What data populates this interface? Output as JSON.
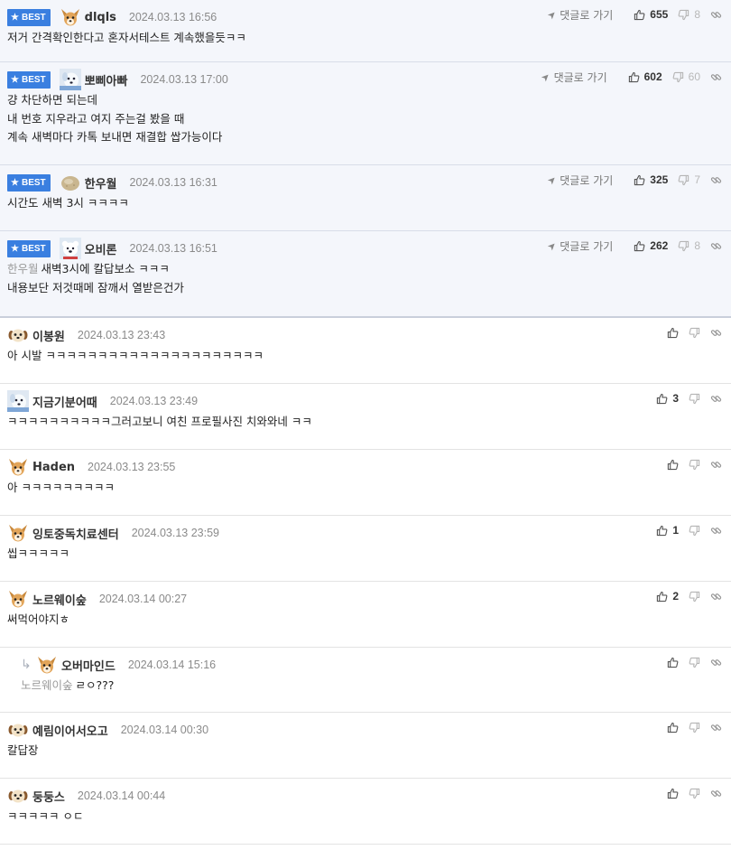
{
  "ui": {
    "best_label": "BEST",
    "goto_label": "댓글로 가기"
  },
  "comments": [
    {
      "best": true,
      "avatar": "dog-tan-icon",
      "nick": "dlqls",
      "date": "2024.03.13 16:56",
      "goto": true,
      "up": "655",
      "down": "8",
      "lines": [
        "저거 간격확인한다고 혼자서테스트 계속했을듯ㅋㅋ"
      ]
    },
    {
      "best": true,
      "avatar": "dog-white-icon",
      "nick": "뽀삐아빠",
      "date": "2024.03.13 17:00",
      "goto": true,
      "up": "602",
      "down": "60",
      "lines": [
        "걍 차단하면 되는데",
        "내 번호 지우라고 여지 주는걸 봤을 때",
        "계속 새벽마다 카톡 보내면 재결합 쌉가능이다"
      ]
    },
    {
      "best": true,
      "avatar": "potato-icon",
      "nick": "한우월",
      "date": "2024.03.13 16:31",
      "goto": true,
      "up": "325",
      "down": "7",
      "lines": [
        "시간도 새벽 3시 ㅋㅋㅋㅋ"
      ]
    },
    {
      "best": true,
      "avatar": "polar-bear-icon",
      "nick": "오비론",
      "date": "2024.03.13 16:51",
      "goto": true,
      "up": "262",
      "down": "8",
      "quote": "한우월",
      "lines": [
        "새벽3시에 칼답보소 ㅋㅋㅋ",
        "내용보단 저것때메 잠깨서 열받은건가"
      ]
    },
    {
      "best": false,
      "avatar": "puppy-icon",
      "nick": "이봉원",
      "date": "2024.03.13 23:43",
      "up": "",
      "down": "",
      "lines": [
        "아 시발 ㅋㅋㅋㅋㅋㅋㅋㅋㅋㅋㅋㅋㅋㅋㅋㅋㅋㅋㅋㅋㅋ"
      ]
    },
    {
      "best": false,
      "avatar": "dog-white-icon",
      "nick": "지금기분어때",
      "date": "2024.03.13 23:49",
      "up": "3",
      "down": "",
      "lines": [
        "ㅋㅋㅋㅋㅋㅋㅋㅋㅋㅋ그러고보니 여친 프로필사진 치와와네 ㅋㅋ"
      ]
    },
    {
      "best": false,
      "avatar": "dog-tan-icon",
      "nick": "Haden",
      "date": "2024.03.13 23:55",
      "up": "",
      "down": "",
      "lines": [
        "아 ㅋㅋㅋㅋㅋㅋㅋㅋㅋ"
      ]
    },
    {
      "best": false,
      "avatar": "dog-tan-icon",
      "nick": "잉토중독치료센터",
      "date": "2024.03.13 23:59",
      "up": "1",
      "down": "",
      "lines": [
        "씹ㅋㅋㅋㅋㅋ"
      ]
    },
    {
      "best": false,
      "avatar": "dog-tan-icon",
      "nick": "노르웨이숲",
      "date": "2024.03.14 00:27",
      "up": "2",
      "down": "",
      "lines": [
        "써먹어야지ㅎ"
      ]
    },
    {
      "best": false,
      "reply": true,
      "avatar": "dog-tan-icon",
      "nick": "오버마인드",
      "date": "2024.03.14 15:16",
      "up": "",
      "down": "",
      "quote": "노르웨이숲",
      "lines": [
        "ㄹㅇ???"
      ]
    },
    {
      "best": false,
      "avatar": "puppy-icon",
      "nick": "예림이어서오고",
      "date": "2024.03.14 00:30",
      "up": "",
      "down": "",
      "lines": [
        "칼답장"
      ]
    },
    {
      "best": false,
      "avatar": "puppy-icon",
      "nick": "둥둥스",
      "date": "2024.03.14 00:44",
      "up": "",
      "down": "",
      "lines": [
        "ㅋㅋㅋㅋㅋ ㅇㄷ"
      ]
    }
  ],
  "colors": {
    "best_bg": "#f4f6fb",
    "badge": "#3a7fe0",
    "divider": "#e3e3e3"
  }
}
